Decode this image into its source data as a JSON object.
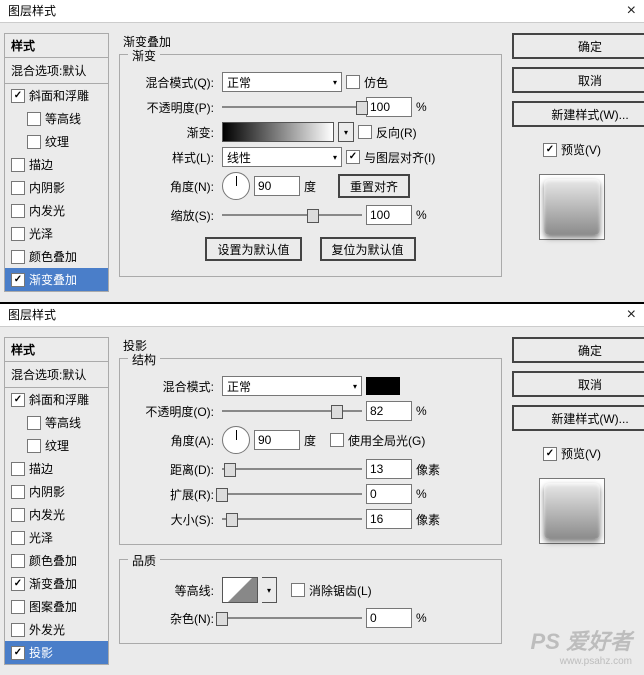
{
  "dlg1": {
    "title": "图层样式",
    "styles_head": "样式",
    "blend_opts": "混合选项:默认",
    "items": [
      {
        "label": "斜面和浮雕",
        "checked": true,
        "indent": false
      },
      {
        "label": "等高线",
        "checked": false,
        "indent": true
      },
      {
        "label": "纹理",
        "checked": false,
        "indent": true
      },
      {
        "label": "描边",
        "checked": false,
        "indent": false
      },
      {
        "label": "内阴影",
        "checked": false,
        "indent": false
      },
      {
        "label": "内发光",
        "checked": false,
        "indent": false
      },
      {
        "label": "光泽",
        "checked": false,
        "indent": false
      },
      {
        "label": "颜色叠加",
        "checked": false,
        "indent": false
      },
      {
        "label": "渐变叠加",
        "checked": true,
        "indent": false,
        "selected": true
      }
    ],
    "group_title": "渐变叠加",
    "sub_title": "渐变",
    "blend_mode_label": "混合模式(Q):",
    "blend_mode_value": "正常",
    "dither": "仿色",
    "opacity_label": "不透明度(P):",
    "opacity_value": "100",
    "pct": "%",
    "gradient_label": "渐变:",
    "reverse": "反向(R)",
    "style_label": "样式(L):",
    "style_value": "线性",
    "align": "与图层对齐(I)",
    "angle_label": "角度(N):",
    "angle_value": "90",
    "deg": "度",
    "reset_align": "重置对齐",
    "scale_label": "缩放(S):",
    "scale_value": "100",
    "set_default": "设置为默认值",
    "reset_default": "复位为默认值",
    "ok": "确定",
    "cancel": "取消",
    "new_style": "新建样式(W)...",
    "preview": "预览(V)"
  },
  "dlg2": {
    "title": "图层样式",
    "styles_head": "样式",
    "blend_opts": "混合选项:默认",
    "items": [
      {
        "label": "斜面和浮雕",
        "checked": true,
        "indent": false
      },
      {
        "label": "等高线",
        "checked": false,
        "indent": true
      },
      {
        "label": "纹理",
        "checked": false,
        "indent": true
      },
      {
        "label": "描边",
        "checked": false,
        "indent": false
      },
      {
        "label": "内阴影",
        "checked": false,
        "indent": false
      },
      {
        "label": "内发光",
        "checked": false,
        "indent": false
      },
      {
        "label": "光泽",
        "checked": false,
        "indent": false
      },
      {
        "label": "颜色叠加",
        "checked": false,
        "indent": false
      },
      {
        "label": "渐变叠加",
        "checked": true,
        "indent": false
      },
      {
        "label": "图案叠加",
        "checked": false,
        "indent": false
      },
      {
        "label": "外发光",
        "checked": false,
        "indent": false
      },
      {
        "label": "投影",
        "checked": true,
        "indent": false,
        "selected": true
      }
    ],
    "group_title": "投影",
    "sub_title": "结构",
    "blend_mode_label": "混合模式:",
    "blend_mode_value": "正常",
    "opacity_label": "不透明度(O):",
    "opacity_value": "82",
    "pct": "%",
    "angle_label": "角度(A):",
    "angle_value": "90",
    "deg": "度",
    "global_light": "使用全局光(G)",
    "distance_label": "距离(D):",
    "distance_value": "13",
    "px": "像素",
    "spread_label": "扩展(R):",
    "spread_value": "0",
    "size_label": "大小(S):",
    "size_value": "16",
    "quality_title": "品质",
    "contour_label": "等高线:",
    "antialias": "消除锯齿(L)",
    "noise_label": "杂色(N):",
    "noise_value": "0",
    "ok": "确定",
    "cancel": "取消",
    "new_style": "新建样式(W)...",
    "preview": "预览(V)"
  },
  "watermark_big": "PS 爱好者",
  "watermark_small": "www.psahz.com"
}
